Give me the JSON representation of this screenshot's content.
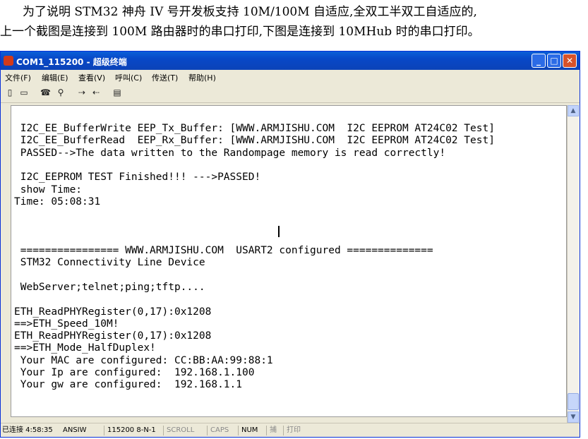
{
  "document": {
    "line1": "为了说明 STM32 神舟 IV 号开发板支持 10M/100M 自适应,全双工半双工自适应的,",
    "line2": "上一个截图是连接到 100M 路由器时的串口打印,下图是连接到 10MHub 时的串口打印。"
  },
  "window": {
    "title": "COM1_115200 - 超级终端",
    "controls": {
      "minimize": "_",
      "maximize": "□",
      "close": "✕"
    }
  },
  "menu": [
    "文件(F)",
    "编辑(E)",
    "查看(V)",
    "呼叫(C)",
    "传送(T)",
    "帮助(H)"
  ],
  "toolbar": [
    {
      "icon": "new-icon",
      "glyph": "▯"
    },
    {
      "icon": "open-icon",
      "glyph": "▭"
    },
    {
      "icon": "call-icon",
      "glyph": "☎"
    },
    {
      "icon": "disconnect-icon",
      "glyph": "⚲"
    },
    {
      "icon": "send-icon",
      "glyph": "⇢"
    },
    {
      "icon": "receive-icon",
      "glyph": "⇠"
    },
    {
      "icon": "properties-icon",
      "glyph": "▤"
    }
  ],
  "terminal": {
    "lines": [
      " I2C_EE_BufferWrite EEP_Tx_Buffer: [WWW.ARMJISHU.COM  I2C EEPROM AT24C02 Test]",
      " I2C_EE_BufferRead  EEP_Rx_Buffer: [WWW.ARMJISHU.COM  I2C EEPROM AT24C02 Test]",
      " PASSED-->The data written to the Randompage memory is read correctly!",
      "",
      " I2C_EEPROM TEST Finished!!! --->PASSED!",
      " show Time:",
      "Time: 05:08:31",
      "",
      "",
      "",
      " ================ WWW.ARMJISHU.COM  USART2 configured ==============",
      " STM32 Connectivity Line Device",
      "",
      " WebServer;telnet;ping;tftp....",
      "",
      "ETH_ReadPHYRegister(0,17):0x1208",
      "==>ETH_Speed_10M!",
      "ETH_ReadPHYRegister(0,17):0x1208",
      "==>ETH_Mode_HalfDuplex!",
      " Your MAC are configured: CC:BB:AA:99:88:1",
      " Your Ip are configured:  192.168.1.100",
      " Your gw are configured:  192.168.1.1"
    ]
  },
  "status": {
    "connection": "已连接 4:58:35",
    "emulation": "ANSIW",
    "port_settings": "115200 8-N-1",
    "scroll": "SCROLL",
    "caps": "CAPS",
    "num": "NUM",
    "capture": "捕",
    "print": "打印"
  }
}
